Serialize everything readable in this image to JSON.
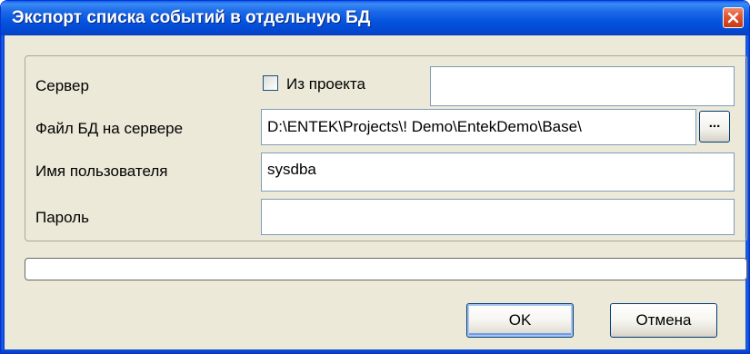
{
  "window": {
    "title": "Экспорт списка событий в отдельную БД"
  },
  "form": {
    "server_label": "Сервер",
    "from_project_label": "Из проекта",
    "from_project_checked": false,
    "server_value": "",
    "db_file_label": "Файл БД на сервере",
    "db_file_value": "D:\\ENTEK\\Projects\\! Demo\\EntekDemo\\Base\\",
    "browse_label": "...",
    "username_label": "Имя пользователя",
    "username_value": "sysdba",
    "password_label": "Пароль",
    "password_value": ""
  },
  "progress": {
    "value_percent": 0
  },
  "buttons": {
    "ok_label": "OK",
    "cancel_label": "Отмена"
  },
  "colors": {
    "titlebar": "#0553df",
    "dialog_bg": "#ece9d8",
    "close_button": "#e0542f"
  }
}
